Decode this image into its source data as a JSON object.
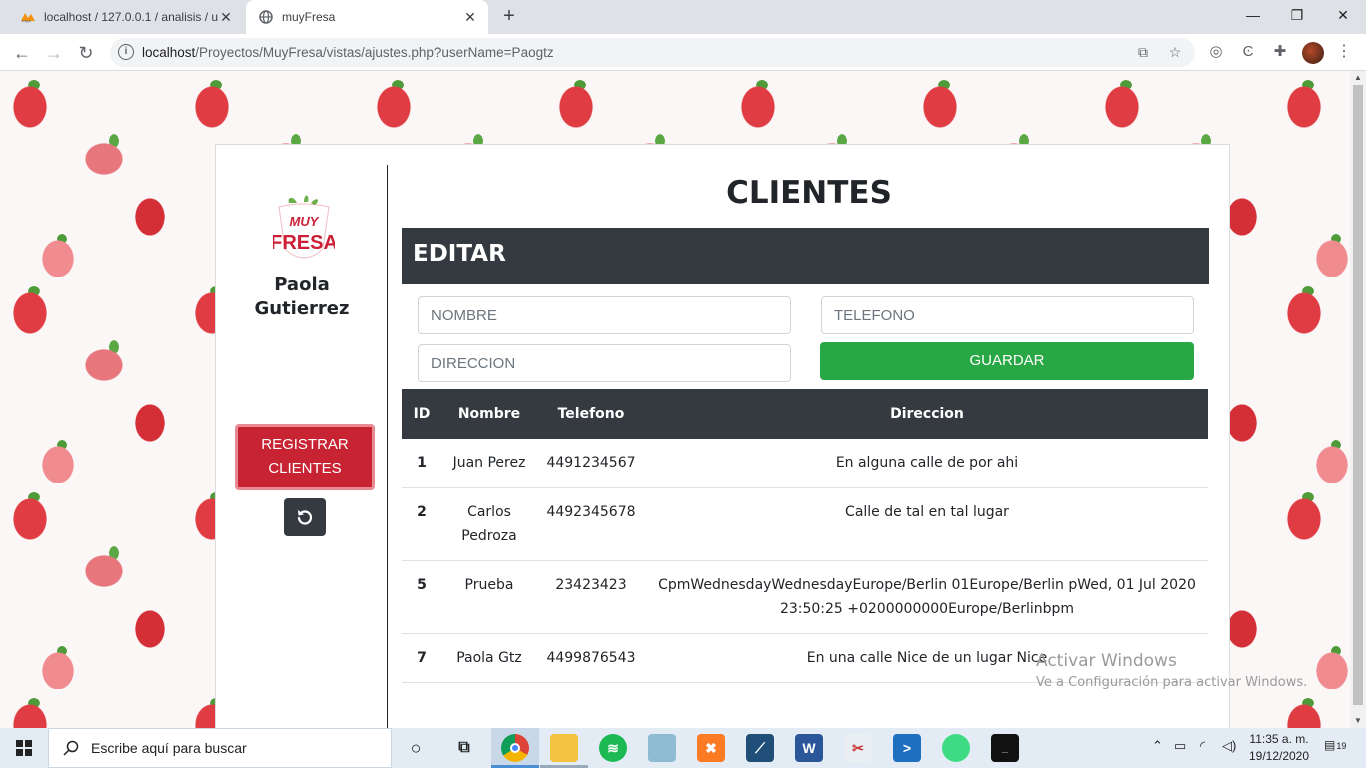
{
  "browser": {
    "tabs": [
      {
        "title": "localhost / 127.0.0.1 / analisis / u"
      },
      {
        "title": "muyFresa"
      }
    ],
    "url": {
      "host": "localhost",
      "path": "/Proyectos/MuyFresa/vistas/ajustes.php?userName=Paogtz"
    },
    "new_tab": "+",
    "window": {
      "minimize": "—",
      "restore": "❐",
      "close": "✕"
    }
  },
  "sidebar": {
    "logo_line1": "MUY",
    "logo_line2": "FRESA",
    "user_first": "Paola",
    "user_last": "Gutierrez",
    "register_line1": "REGISTRAR",
    "register_line2": "CLIENTES"
  },
  "main": {
    "title": "CLIENTES",
    "edit_header": "EDITAR",
    "form": {
      "nombre_placeholder": "NOMBRE",
      "telefono_placeholder": "TELEFONO",
      "direccion_placeholder": "DIRECCION",
      "save_label": "GUARDAR"
    },
    "table": {
      "headers": [
        "ID",
        "Nombre",
        "Telefono",
        "Direccion"
      ],
      "rows": [
        {
          "id": "1",
          "nombre": "Juan Perez",
          "telefono": "4491234567",
          "direccion": "En alguna calle de por ahi"
        },
        {
          "id": "2",
          "nombre": "Carlos Pedroza",
          "telefono": "4492345678",
          "direccion": "Calle de tal en tal lugar"
        },
        {
          "id": "5",
          "nombre": "Prueba",
          "telefono": "23423423",
          "direccion": "CpmWednesdayWednesdayEurope/Berlin 01Europe/Berlin pWed, 01 Jul 2020 23:50:25 +0200000000Europe/Berlinbpm"
        },
        {
          "id": "7",
          "nombre": "Paola Gtz",
          "telefono": "4499876543",
          "direccion": "En una calle Nice de un lugar Nice"
        }
      ]
    }
  },
  "watermark": {
    "line1": "Activar Windows",
    "line2": "Ve a Configuración para activar Windows."
  },
  "taskbar": {
    "search_placeholder": "Escribe aquí para buscar",
    "time": "11:35 a. m.",
    "date": "19/12/2020",
    "notification_count": "19"
  },
  "colors": {
    "dark": "#343a40",
    "danger": "#c82333",
    "success": "#28a745",
    "strawberry": "#e03c43"
  }
}
